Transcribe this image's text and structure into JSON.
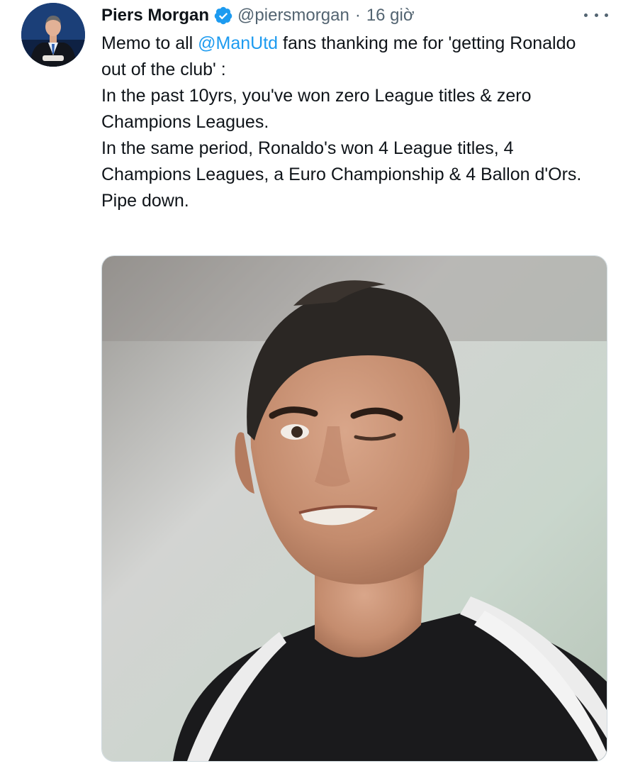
{
  "tweet": {
    "author": {
      "display_name": "Piers Morgan",
      "verified_icon": "verified-badge-icon",
      "handle": "@piersmorgan",
      "separator": "·",
      "time": "16 giờ"
    },
    "more_icon": "more-horizontal-icon",
    "text": {
      "line1_before": "Memo to all ",
      "mention": "@ManUtd",
      "line1_after": " fans thanking me for 'getting Ronaldo out of the club' :",
      "paragraph2": "In the past 10yrs, you've won zero League titles & zero Champions Leagues.",
      "paragraph3": "In the same period, Ronaldo's won 4 League titles, 4 Champions Leagues, a Euro Championship & 4 Ballon d'Ors.",
      "paragraph4": "Pipe down."
    },
    "colors": {
      "link": "#1d9bf0",
      "verified": "#1d9bf0",
      "secondary_text": "#536471",
      "primary_text": "#0f1419"
    }
  }
}
